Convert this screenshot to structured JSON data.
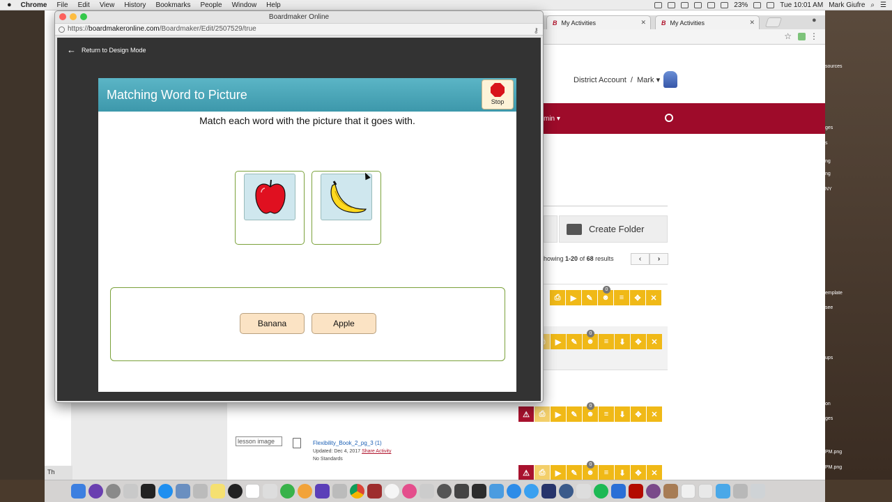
{
  "menubar": {
    "items": [
      "Chrome",
      "File",
      "Edit",
      "View",
      "History",
      "Bookmarks",
      "People",
      "Window",
      "Help"
    ],
    "battery": "23%",
    "clock": "Tue 10:01 AM",
    "user": "Mark Giufre"
  },
  "bg_browser": {
    "tabs": [
      "My Activities",
      "My Activities"
    ],
    "tab_favicon": "B",
    "account": "District Account",
    "user": "Mark",
    "nav_partial": "min",
    "create_folder": "Create Folder",
    "results": {
      "prefix": "howing",
      "range": "1-20",
      "of": "of",
      "total": "68",
      "suffix": "results"
    },
    "badge_count": "0",
    "lesson": {
      "image_alt": "lesson image",
      "title": "Flexibility_Book_2_pg_3 (1)",
      "updated": "Updated: Dec 4, 2017",
      "share": "Share Activity",
      "standards": "No Standards"
    },
    "bottom_tab": "Th",
    "desktop_labels": [
      "sources",
      "ges",
      "s",
      "ng",
      "ng",
      "NY",
      "emplate",
      "see",
      "ups",
      "on",
      "ges",
      "PM.png",
      "PM.png"
    ]
  },
  "window": {
    "title": "Boardmaker Online",
    "url_prefix": "https://",
    "url_domain": "boardmakeronline.com",
    "url_path": "/Boardmaker/Edit/2507529/true",
    "back_label": "Return to Design Mode"
  },
  "activity": {
    "title": "Matching Word to Picture",
    "stop_label": "Stop",
    "instruction": "Match each word with the picture that it goes with.",
    "pictures": [
      "apple",
      "banana"
    ],
    "words": [
      "Banana",
      "Apple"
    ]
  },
  "colors": {
    "header_teal": "#4aa7b9",
    "card_border": "#7aa13a",
    "word_tile": "#fbe3c4",
    "brand_red": "#9e0b2a",
    "toolbar_yellow": "#f0b917"
  },
  "icons": {
    "back": "arrow-left-icon",
    "stop": "stop-sign-icon",
    "search": "search-icon",
    "folder": "folder-plus-icon"
  }
}
